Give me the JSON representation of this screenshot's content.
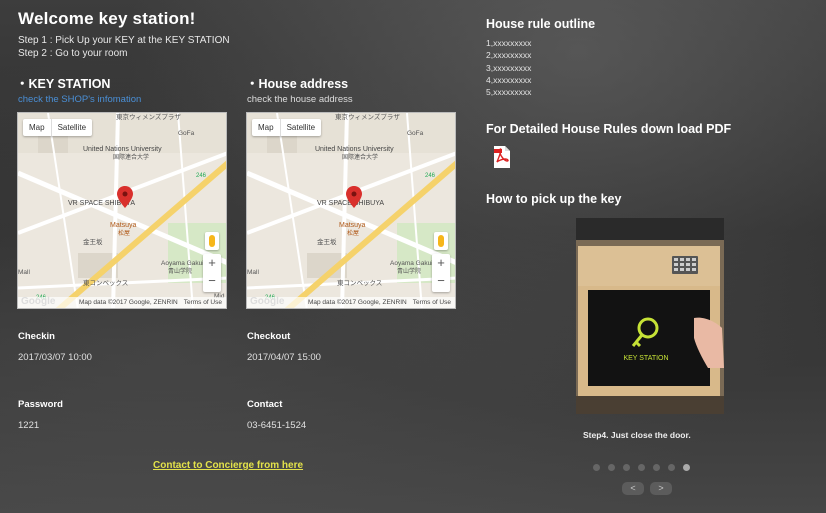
{
  "header": {
    "title": "Welcome key station!",
    "step1": "Step 1 : Pick Up your KEY at the KEY STATION",
    "step2": "Step 2 : Go to your room"
  },
  "key_station": {
    "heading": "・KEY STATION",
    "link": "check the SHOP's infomation"
  },
  "house_address": {
    "heading": "・House address",
    "link": "check the house address"
  },
  "map": {
    "btn_map": "Map",
    "btn_satellite": "Satellite",
    "zoom_in": "+",
    "zoom_out": "−",
    "attribution": "Map data ©2017 Google, ZENRIN",
    "terms": "Terms of Use",
    "logo": "Google",
    "labels": {
      "un": "United Nations University",
      "un_jp": "国際連合大学",
      "vr": "VR SPACE SHIBUYA",
      "matsuya": "Matsuya",
      "matsuya_jp": "松屋",
      "kaneboku": "金王坂",
      "aoyama": "Aoyama Gakuin Uni",
      "aoyama_jp": "青山学院",
      "gofa": "GoFa",
      "tokyo": "東京ウィメンズプラザ",
      "conbex": "東コンベックス",
      "route": "246",
      "mall": "Mall",
      "mid": "Mid"
    }
  },
  "checkin": {
    "label": "Checkin",
    "value": "2017/03/07 10:00"
  },
  "checkout": {
    "label": "Checkout",
    "value": "2017/04/07 15:00"
  },
  "password": {
    "label": "Password",
    "value": "1221"
  },
  "contact": {
    "label": "Contact",
    "value": "03-6451-1524"
  },
  "concierge_link": "Contact to Concierge from here",
  "house_rules": {
    "heading": "House rule outline",
    "items": [
      "1,xxxxxxxxx",
      "2,xxxxxxxxx",
      "3,xxxxxxxxx",
      "4,xxxxxxxxx",
      "5,xxxxxxxxx"
    ]
  },
  "pdf": {
    "heading": "For Detailed House Rules down load PDF",
    "icon": "pdf-file-icon"
  },
  "pickup": {
    "heading": "How to pick up the key",
    "photo_logo": "KEY STATION",
    "caption": "Step4. Just close the door.",
    "slide_count": 7,
    "active_slide": 7,
    "prev": "<",
    "next": ">"
  },
  "colors": {
    "link_blue": "#4a8fd6",
    "concierge_yellow": "#e3e24a",
    "pin_red": "#d9302c",
    "key_green": "#c6e236"
  }
}
